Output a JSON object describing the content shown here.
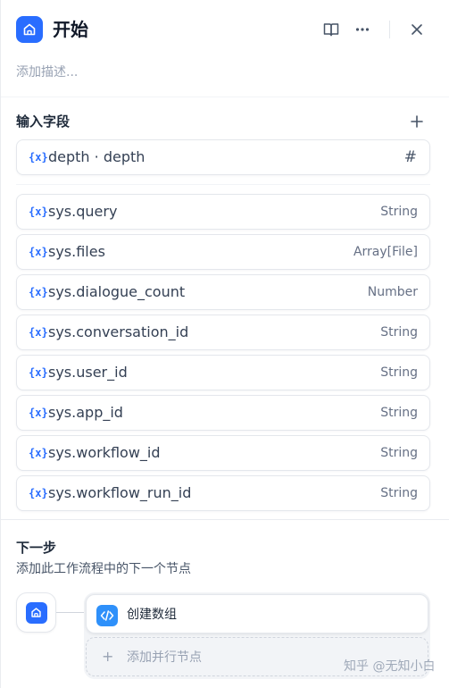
{
  "header": {
    "title": "开始",
    "description_placeholder": "添加描述..."
  },
  "input_fields": {
    "title": "输入字段",
    "user_fields": [
      {
        "name": "depth · depth",
        "type_icon": "hash-icon",
        "type_glyph": "#"
      }
    ],
    "system_fields": [
      {
        "name": "sys.query",
        "type": "String"
      },
      {
        "name": "sys.files",
        "type": "Array[File]"
      },
      {
        "name": "sys.dialogue_count",
        "type": "Number"
      },
      {
        "name": "sys.conversation_id",
        "type": "String"
      },
      {
        "name": "sys.user_id",
        "type": "String"
      },
      {
        "name": "sys.app_id",
        "type": "String"
      },
      {
        "name": "sys.workflow_id",
        "type": "String"
      },
      {
        "name": "sys.workflow_run_id",
        "type": "String"
      }
    ],
    "variable_icon_glyph": "{x}"
  },
  "next_step": {
    "title": "下一步",
    "description": "添加此工作流程中的下一个节点",
    "next_node_label": "创建数组",
    "add_parallel_label": "添加并行节点",
    "add_parallel_glyph": "+"
  },
  "watermark": "知乎 @无知小白",
  "colors": {
    "accent": "#296dff",
    "code_node": "#2e90fa",
    "muted_text": "#98a2b3",
    "border": "#e4e7ec"
  }
}
